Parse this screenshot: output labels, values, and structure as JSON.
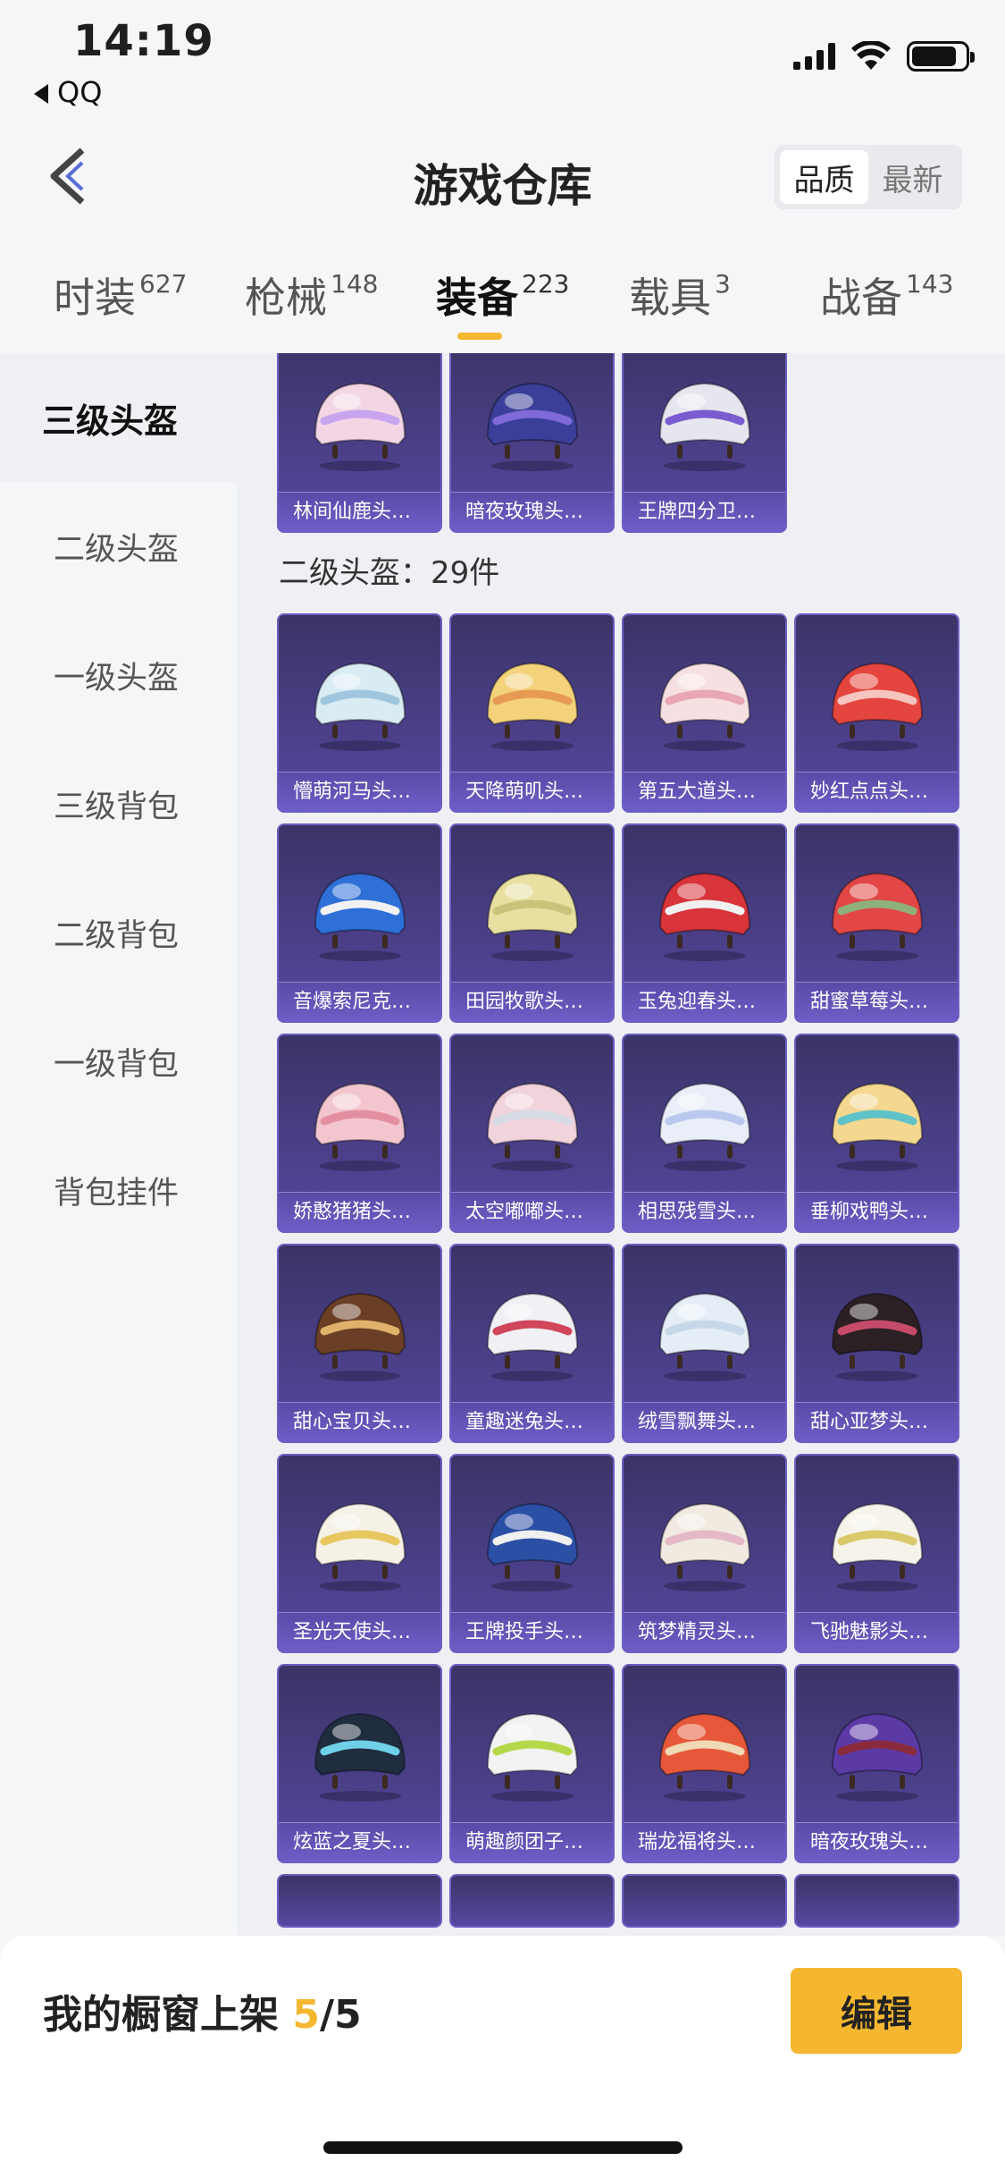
{
  "status_bar": {
    "time": "14:19",
    "back_app": "QQ",
    "icons": [
      "signal-icon",
      "wifi-icon",
      "battery-icon"
    ],
    "battery_level": 0.85
  },
  "header": {
    "title": "游戏仓库",
    "sort_options": [
      "品质",
      "最新"
    ],
    "active_sort": "品质"
  },
  "tabs": [
    {
      "label": "时装",
      "count": "627"
    },
    {
      "label": "枪械",
      "count": "148"
    },
    {
      "label": "装备",
      "count": "223",
      "active": true
    },
    {
      "label": "载具",
      "count": "3"
    },
    {
      "label": "战备",
      "count": "143"
    }
  ],
  "sidebar": [
    {
      "label": "三级头盔",
      "active": true
    },
    {
      "label": "二级头盔"
    },
    {
      "label": "一级头盔"
    },
    {
      "label": "三级背包"
    },
    {
      "label": "二级背包"
    },
    {
      "label": "一级背包"
    },
    {
      "label": "背包挂件"
    }
  ],
  "level3_items": [
    "林间仙鹿头…",
    "暗夜玫瑰头…",
    "王牌四分卫…"
  ],
  "level2_section_title": "二级头盔：29件",
  "level2_items": [
    "懵萌河马头…",
    "天降萌叽头…",
    "第五大道头…",
    "妙红点点头…",
    "音爆索尼克…",
    "田园牧歌头…",
    "玉兔迎春头…",
    "甜蜜草莓头…",
    "娇憨猪猪头…",
    "太空嘟嘟头…",
    "相思残雪头…",
    "垂柳戏鸭头…",
    "甜心宝贝头…",
    "童趣迷兔头…",
    "绒雪飘舞头…",
    "甜心亚梦头…",
    "圣光天使头…",
    "王牌投手头…",
    "筑梦精灵头…",
    "飞驰魅影头…",
    "炫蓝之夏头…",
    "萌趣颜团子…",
    "瑞龙福将头…",
    "暗夜玫瑰头…"
  ],
  "bottom_bar": {
    "shop_label": "我的橱窗上架",
    "shop_count": "5",
    "shop_total": "/5",
    "edit_label": "编辑"
  },
  "colors": {
    "accent": "#f5b72f",
    "card_bg": "#4a3f86",
    "card_border": "#6d5fc4"
  }
}
